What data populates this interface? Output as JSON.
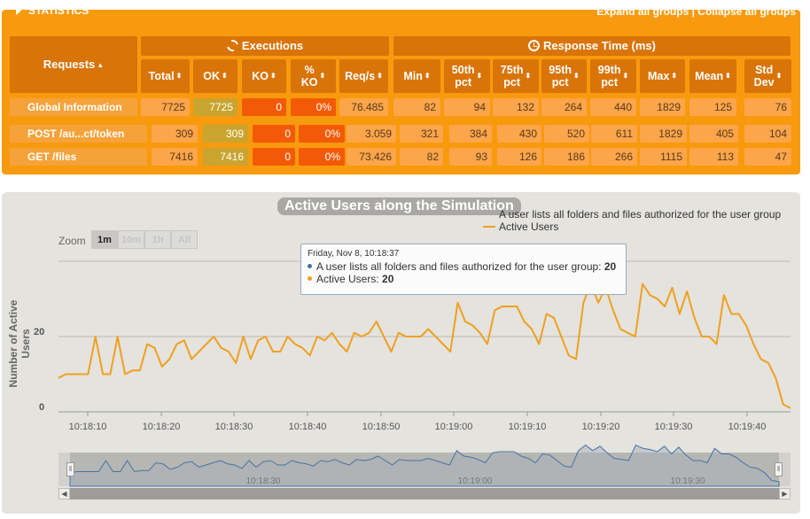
{
  "stats": {
    "title": "STATISTICS",
    "expand_label": "Expand all groups",
    "separator": " | ",
    "collapse_label": "Collapse all groups",
    "requests_header": "Requests",
    "executions_header": "Executions",
    "response_time_header": "Response Time (ms)",
    "columns": [
      "Total",
      "OK",
      "KO",
      "%\nKO",
      "Req/s",
      "Min",
      "50th\npct",
      "75th\npct",
      "95th\npct",
      "99th\npct",
      "Max",
      "Mean",
      "Std\nDev"
    ],
    "rows": [
      {
        "name": "Global Information",
        "values": [
          "7725",
          "7725",
          "0",
          "0%",
          "76.485",
          "82",
          "94",
          "132",
          "264",
          "440",
          "1829",
          "125",
          "76"
        ]
      },
      {
        "name": "POST /au...ct/token",
        "values": [
          "309",
          "309",
          "0",
          "0%",
          "3.059",
          "321",
          "384",
          "430",
          "520",
          "611",
          "1829",
          "405",
          "104"
        ]
      },
      {
        "name": "GET /files",
        "values": [
          "7416",
          "7416",
          "0",
          "0%",
          "73.426",
          "82",
          "93",
          "126",
          "186",
          "266",
          "1115",
          "113",
          "47"
        ]
      }
    ]
  },
  "chart": {
    "title": "Active Users along the Simulation",
    "legend": [
      {
        "name": "A user lists all folders and files authorized for the user group",
        "color": "#4572a7"
      },
      {
        "name": "Active Users",
        "color": "#f0a020"
      }
    ],
    "zoom_label": "Zoom",
    "zoom_buttons": [
      "1m",
      "10m",
      "1h",
      "All"
    ],
    "tooltip": {
      "date": "Friday, Nov 8, 10:18:37",
      "line1_label": "A user lists all folders and files authorized for the user group: ",
      "line1_value": "20",
      "line2_label": "Active Users: ",
      "line2_value": "20"
    },
    "navigator_ticks": [
      "10:18:30",
      "10:19:00",
      "10:19:30"
    ]
  },
  "chart_data": {
    "type": "line",
    "title": "Active Users along the Simulation",
    "xlabel": "",
    "ylabel": "Number of Active Users",
    "ylim": [
      0,
      40
    ],
    "yticks": [
      "0",
      "20"
    ],
    "xticks": [
      "10:18:10",
      "10:18:20",
      "10:18:30",
      "10:18:40",
      "10:18:50",
      "10:19:00",
      "10:19:10",
      "10:19:20",
      "10:19:30",
      "10:19:40"
    ],
    "x_start": "10:18:06",
    "x_end": "10:19:46",
    "series": [
      {
        "name": "Active Users",
        "color": "#f0a020",
        "values": [
          9,
          10,
          10,
          10,
          10,
          20,
          10,
          10,
          20,
          10,
          11,
          11,
          18,
          17,
          12,
          14,
          18,
          19,
          14,
          16,
          18,
          20,
          17,
          16,
          13,
          20,
          14,
          19,
          20,
          16,
          16,
          20,
          18,
          17,
          15,
          20,
          19,
          21,
          18,
          16,
          21,
          20,
          21,
          24,
          20,
          16,
          21,
          20,
          20,
          20,
          22,
          20,
          18,
          16,
          29,
          24,
          23,
          21,
          18,
          27,
          28,
          28,
          28,
          24,
          22,
          18,
          26,
          25,
          20,
          15,
          14,
          29,
          34,
          29,
          33,
          27,
          22,
          21,
          20,
          34,
          31,
          30,
          28,
          33,
          26,
          32,
          25,
          20,
          20,
          18,
          31,
          26,
          26,
          23,
          18,
          14,
          13,
          9,
          2,
          1
        ]
      }
    ]
  }
}
